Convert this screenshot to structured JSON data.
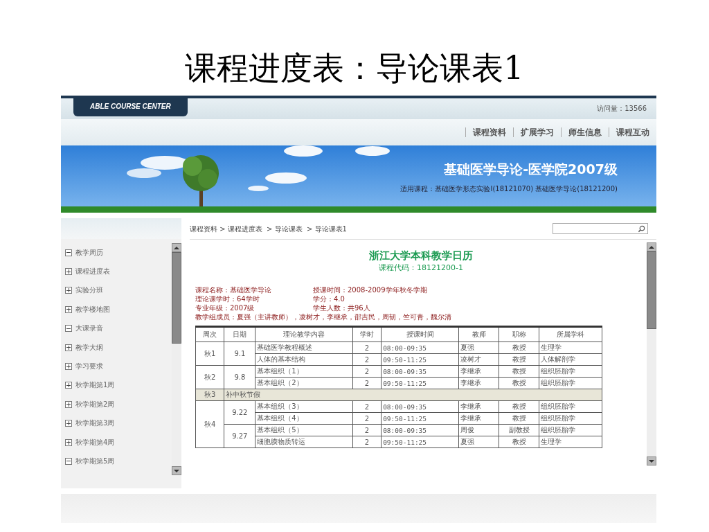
{
  "slide_title": "课程进度表：导论课表1",
  "site": {
    "brand": "ABLE COURSE CENTER",
    "visit_count": "访问量：13566"
  },
  "nav": [
    "课程资料",
    "扩展学习",
    "师生信息",
    "课程互动"
  ],
  "banner": {
    "title": "基础医学导论-医学院2007级",
    "subtitle": "适用课程：基础医学形态实验Ⅰ(18121070) 基础医学导论(18121200)"
  },
  "breadcrumb": "课程资料 > 课程进度表  > 导论课表  > 导论课表1",
  "sidebar": {
    "items": [
      {
        "label": "教学周历",
        "expanded": true
      },
      {
        "label": "课程进度表",
        "expanded": false
      },
      {
        "label": "实验分班",
        "expanded": false
      },
      {
        "label": "教学楼地图",
        "expanded": false
      },
      {
        "label": "大课录音",
        "expanded": true
      },
      {
        "label": "教学大纲",
        "expanded": false
      },
      {
        "label": "学习要求",
        "expanded": false
      },
      {
        "label": "秋学期第1周",
        "expanded": false
      },
      {
        "label": "秋学期第2周",
        "expanded": false
      },
      {
        "label": "秋学期第3周",
        "expanded": false
      },
      {
        "label": "秋学期第4周",
        "expanded": false
      },
      {
        "label": "秋学期第5周",
        "expanded": true
      }
    ]
  },
  "calendar": {
    "title": "浙江大学本科教学日历",
    "code": "课程代码：18121200-1",
    "info": [
      {
        "left": "课程名称：基础医学导论",
        "right": "授课时间：2008-2009学年秋冬学期"
      },
      {
        "left": "理论课学时：64学时",
        "right": "学分：4.0"
      },
      {
        "left": "专业年级：2007级",
        "right": "学生人数：共96人"
      },
      {
        "left": "教学组成员：夏强（主讲教师），凌树才，李继承，邵吉民，周韧，竺可青，魏尔清"
      }
    ]
  },
  "table": {
    "columns": [
      "周次",
      "日期",
      "理论教学内容",
      "学时",
      "授课时间",
      "教师",
      "职称",
      "所属学科"
    ],
    "weeks": [
      {
        "kind": "lessons",
        "week": "秋1",
        "days": [
          {
            "date": "9.1",
            "lessons": [
              {
                "content": "基础医学教程概述",
                "hours": "2",
                "time": "08:00-09:35",
                "teacher": "夏强",
                "rank": "教授",
                "subject": "生理学"
              },
              {
                "content": "人体的基本结构",
                "hours": "2",
                "time": "09:50-11:25",
                "teacher": "凌树才",
                "rank": "教授",
                "subject": "人体解剖学"
              }
            ]
          }
        ]
      },
      {
        "kind": "lessons",
        "week": "秋2",
        "days": [
          {
            "date": "9.8",
            "lessons": [
              {
                "content": "基本组织（1）",
                "hours": "2",
                "time": "08:00-09:35",
                "teacher": "李继承",
                "rank": "教授",
                "subject": "组织胚胎学"
              },
              {
                "content": "基本组织（2）",
                "hours": "2",
                "time": "09:50-11:25",
                "teacher": "李继承",
                "rank": "教授",
                "subject": "组织胚胎学"
              }
            ]
          }
        ]
      },
      {
        "kind": "holiday",
        "week": "秋3",
        "note": "补中秋节假"
      },
      {
        "kind": "lessons",
        "week": "秋4",
        "days": [
          {
            "date": "9.22",
            "lessons": [
              {
                "content": "基本组织（3）",
                "hours": "2",
                "time": "08:00-09:35",
                "teacher": "李继承",
                "rank": "教授",
                "subject": "组织胚胎学"
              },
              {
                "content": "基本组织（4）",
                "hours": "2",
                "time": "09:50-11:25",
                "teacher": "李继承",
                "rank": "教授",
                "subject": "组织胚胎学"
              }
            ]
          },
          {
            "date": "9.27",
            "lessons": [
              {
                "content": "基本组织（5）",
                "hours": "2",
                "time": "08:00-09:35",
                "teacher": "周俊",
                "rank": "副教授",
                "subject": "组织胚胎学"
              },
              {
                "content": "细胞膜物质转运",
                "hours": "2",
                "time": "09:50-11:25",
                "teacher": "夏强",
                "rank": "教授",
                "subject": "生理学"
              }
            ]
          }
        ]
      }
    ]
  }
}
